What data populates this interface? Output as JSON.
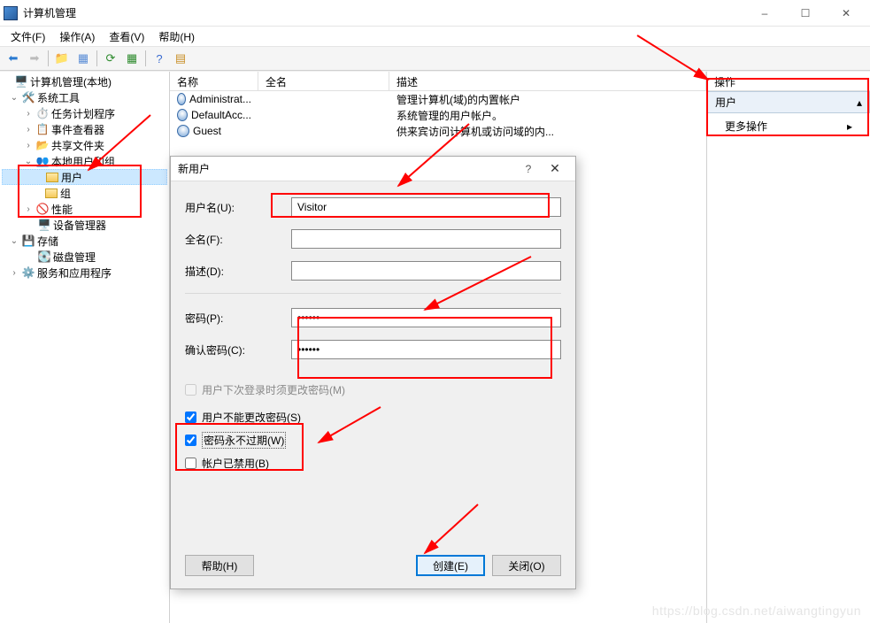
{
  "window": {
    "title": "计算机管理",
    "min_tip": "–",
    "max_tip": "☐",
    "close_tip": "✕"
  },
  "menu": {
    "file": "文件(F)",
    "action": "操作(A)",
    "view": "查看(V)",
    "help": "帮助(H)"
  },
  "tree": {
    "root": "计算机管理(本地)",
    "system_tools": "系统工具",
    "task_scheduler": "任务计划程序",
    "event_viewer": "事件查看器",
    "shared_folders": "共享文件夹",
    "local_users": "本地用户和组",
    "users": "用户",
    "groups": "组",
    "performance": "性能",
    "device_manager": "设备管理器",
    "storage": "存储",
    "disk_mgmt": "磁盘管理",
    "services_apps": "服务和应用程序"
  },
  "list": {
    "col_name": "名称",
    "col_fullname": "全名",
    "col_desc": "描述",
    "rows": [
      {
        "name": "Administrat...",
        "full": "",
        "desc": "管理计算机(域)的内置帐户"
      },
      {
        "name": "DefaultAcc...",
        "full": "",
        "desc": "系统管理的用户帐户。"
      },
      {
        "name": "Guest",
        "full": "",
        "desc": "供来宾访问计算机或访问域的内..."
      }
    ]
  },
  "actions": {
    "header": "操作",
    "section": "用户",
    "more": "更多操作"
  },
  "dialog": {
    "title": "新用户",
    "labels": {
      "username": "用户名(U):",
      "fullname": "全名(F):",
      "desc": "描述(D):",
      "password": "密码(P):",
      "confirm": "确认密码(C):"
    },
    "values": {
      "username": "Visitor",
      "password": "••••••",
      "confirm": "••••••"
    },
    "checks": {
      "must_change": "用户下次登录时须更改密码(M)",
      "cannot_change": "用户不能更改密码(S)",
      "never_expire": "密码永不过期(W)",
      "disabled": "帐户已禁用(B)"
    },
    "buttons": {
      "help": "帮助(H)",
      "create": "创建(E)",
      "close": "关闭(O)"
    }
  },
  "watermark": "https://blog.csdn.net/aiwangtingyun"
}
